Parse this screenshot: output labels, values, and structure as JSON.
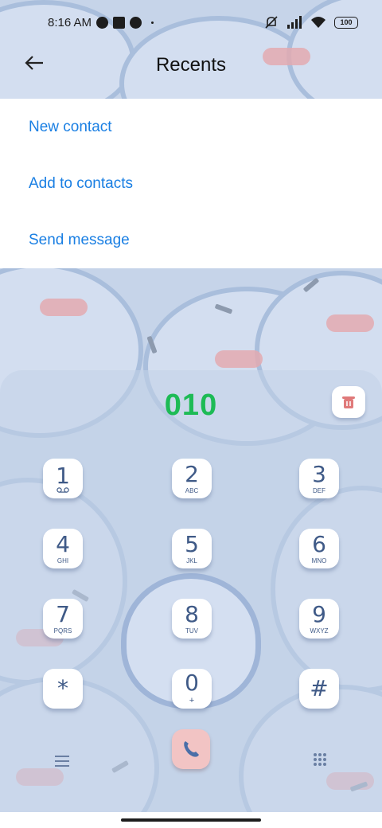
{
  "status_bar": {
    "time": "8:16 AM",
    "battery": "100",
    "icons": [
      "app-notification-icon",
      "square-notification-icon",
      "app-notification-icon",
      "mute-icon",
      "signal-icon",
      "wifi-icon",
      "battery-icon"
    ]
  },
  "header": {
    "back_icon": "back-arrow-icon",
    "title": "Recents"
  },
  "menu": {
    "items": [
      {
        "label": "New contact"
      },
      {
        "label": "Add to contacts"
      },
      {
        "label": "Send message"
      }
    ]
  },
  "dialer": {
    "number": "010",
    "delete_icon": "delete-icon",
    "keys": [
      {
        "digit": "1",
        "letters": "voicemail"
      },
      {
        "digit": "2",
        "letters": "ABC"
      },
      {
        "digit": "3",
        "letters": "DEF"
      },
      {
        "digit": "4",
        "letters": "GHI"
      },
      {
        "digit": "5",
        "letters": "JKL"
      },
      {
        "digit": "6",
        "letters": "MNO"
      },
      {
        "digit": "7",
        "letters": "PQRS"
      },
      {
        "digit": "8",
        "letters": "TUV"
      },
      {
        "digit": "9",
        "letters": "WXYZ"
      },
      {
        "digit": "*",
        "letters": ""
      },
      {
        "digit": "0",
        "letters": "+"
      },
      {
        "digit": "#",
        "letters": ""
      }
    ],
    "call_icon": "phone-icon",
    "menu_icon": "hamburger-menu-icon",
    "keypad_icon": "keypad-grid-icon"
  },
  "colors": {
    "accent_link": "#1a7fe3",
    "number": "#1dbb55",
    "key_text": "#3f5a87",
    "background": "#c6d4e9"
  }
}
